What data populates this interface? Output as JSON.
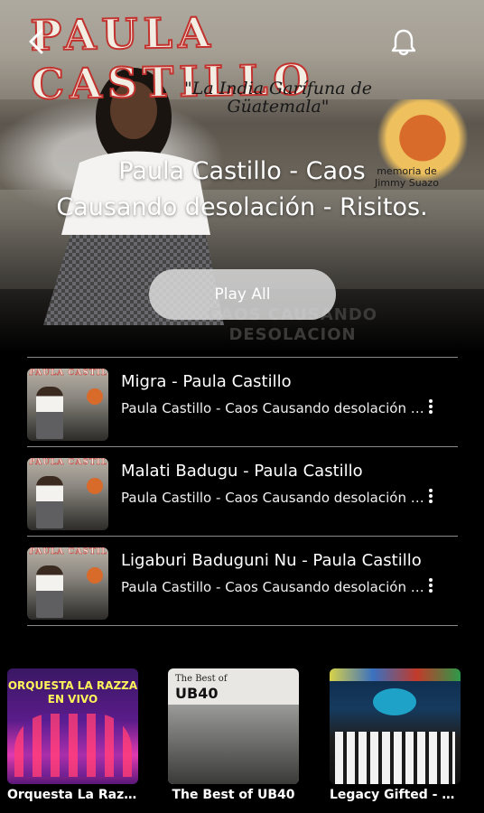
{
  "header": {
    "album_title": "Paula Castillo - Caos\nCausando desolación  - Risitos.",
    "play_all_label": "Play All",
    "art": {
      "brand": "PAULA CASTILLO",
      "subtitle": "\"La India Garífuna de Güatemala\"",
      "memoria": "memoria de\nJimmy Suazo",
      "bottom": "CAOS CAUSANDO\nDESOLACION"
    },
    "icons": {
      "back": "chevron-left-icon",
      "bell": "bell-icon"
    }
  },
  "tracks": [
    {
      "title": "Migra - Paula Castillo",
      "subtitle": "Paula Castillo - Caos Causando desolación - Risitos."
    },
    {
      "title": "Malati Badugu - Paula Castillo",
      "subtitle": "Paula Castillo - Caos Causando desolación - Risitos."
    },
    {
      "title": "Ligaburi Baduguni Nu - Paula Castillo",
      "subtitle": "Paula Castillo - Caos Causando desolación - Risitos."
    }
  ],
  "albums": [
    {
      "name": "Orquesta La Razza En Vivo",
      "cover_text": "ORQUESTA LA RAZZA\nEN VIVO"
    },
    {
      "name": "The Best of UB40",
      "cover_text_small": "The Best of",
      "cover_text_big": "UB40"
    },
    {
      "name": "Legacy Gifted - Punta Hits"
    }
  ],
  "colors": {
    "background": "#000000",
    "play_button": "#dadada",
    "divider": "#8a8a8a"
  }
}
